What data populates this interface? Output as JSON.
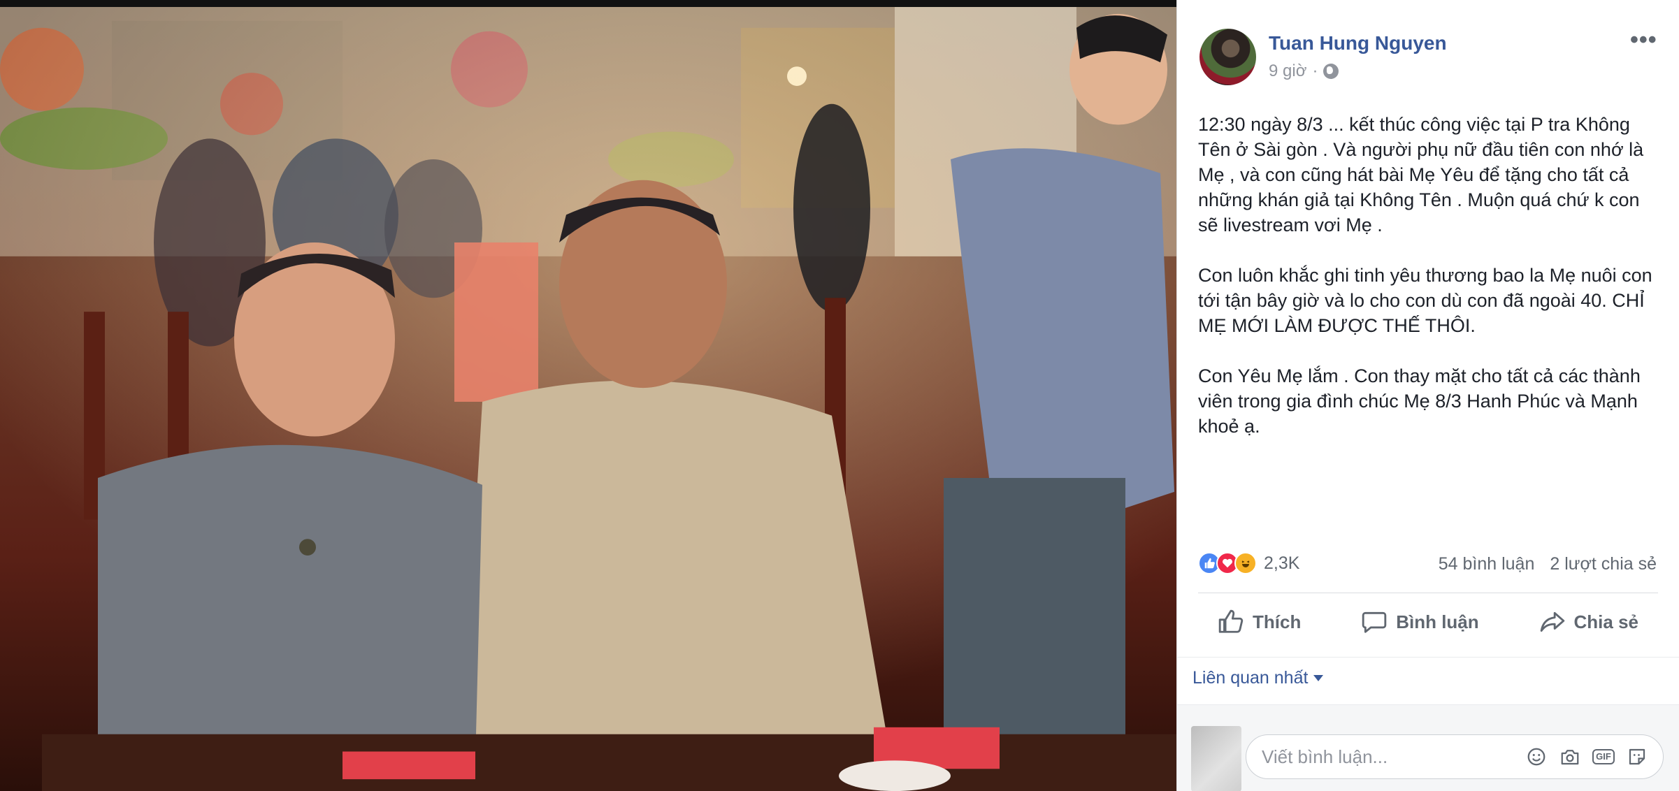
{
  "post": {
    "author": "Tuan Hung Nguyen",
    "time": "9 giờ",
    "separator": "·",
    "privacy_icon": "globe-icon",
    "more_label": "•••",
    "paragraphs": [
      "12:30 ngày 8/3 ... kết thúc công việc tại P tra Không Tên ở Sài gòn . Và người phụ nữ đầu tiên con nhớ là Mẹ , và con cũng hát bài Mẹ Yêu để tặng cho tất cả những khán giả tại Không Tên . Muộn quá chứ k con sẽ livestream vơi Mẹ .",
      "Con luôn khắc ghi tinh yêu thương bao la Mẹ nuôi con tới tận bây giờ và lo cho con dù con đã ngoài 40. CHỈ MẸ MỚI LÀM ĐƯỢC THẾ THÔI.",
      "Con Yêu Mẹ lắm . Con thay mặt cho tất cả các thành viên trong gia đình chúc Mẹ 8/3 Hanh Phúc và Mạnh khoẻ ạ."
    ]
  },
  "stats": {
    "reactions_count": "2,3K",
    "comments": "54 bình luận",
    "shares": "2 lượt chia sẻ"
  },
  "actions": {
    "like": "Thích",
    "comment": "Bình luận",
    "share": "Chia sẻ"
  },
  "related_label": "Liên quan nhất",
  "composer": {
    "placeholder": "Viết bình luận...",
    "gif_label": "GIF"
  },
  "colors": {
    "link_blue": "#385898",
    "meta_grey": "#90949c",
    "like_blue": "#4a86f4",
    "love_red": "#f0284a",
    "haha_yellow": "#f7b125"
  }
}
